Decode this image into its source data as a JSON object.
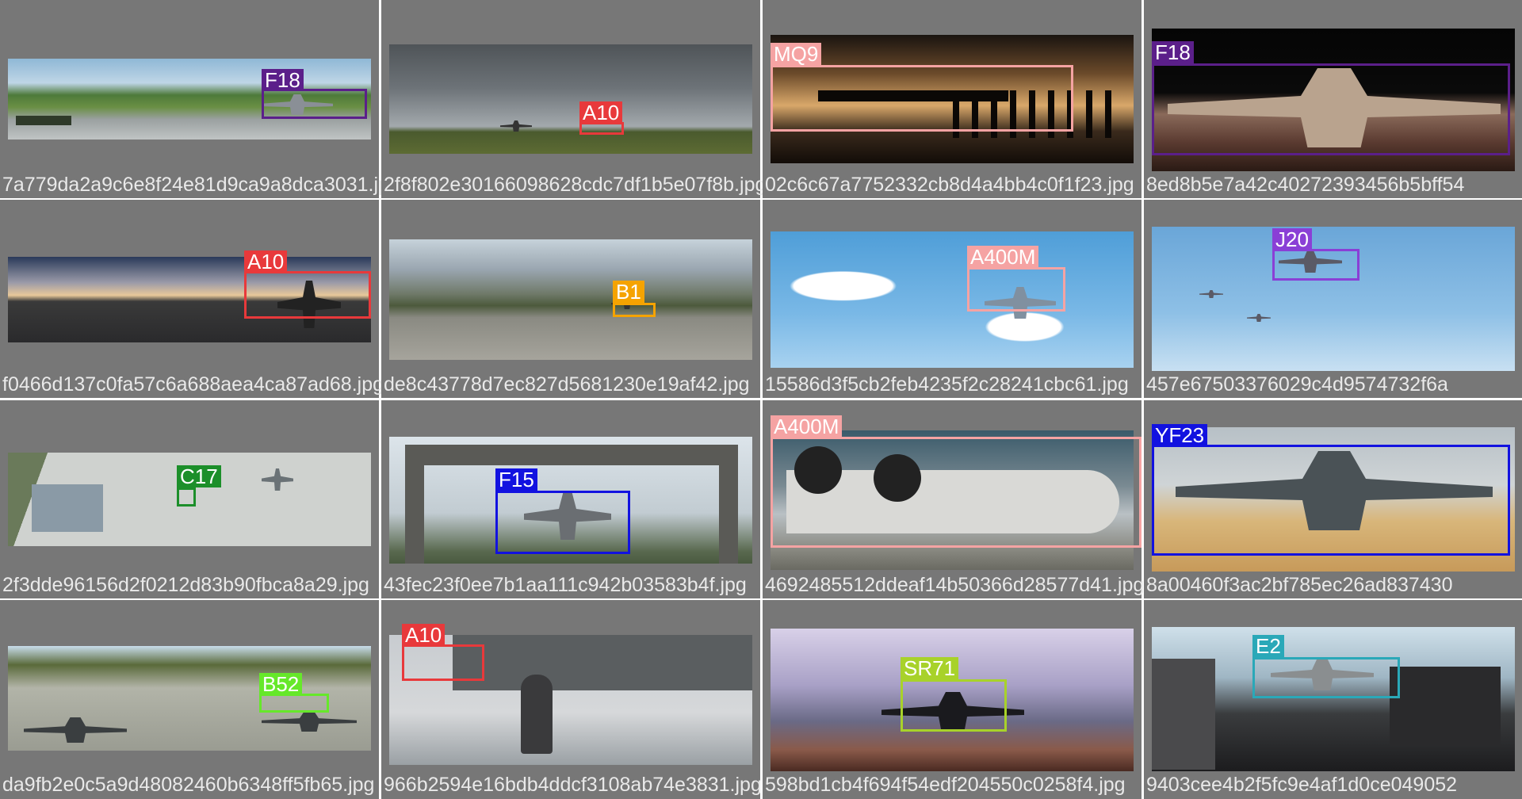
{
  "cells": [
    {
      "filename": "7a779da2a9c6e8f24e81d9ca9a8dca3031.jpg",
      "label": "F18",
      "color": "#5B1F8A"
    },
    {
      "filename": "2f8f802e30166098628cdc7df1b5e07f8b.jpg",
      "label": "A10",
      "color": "#E8393B"
    },
    {
      "filename": "02c6c67a7752332cb8d4a4bb4c0f1f23.jpg",
      "label": "MQ9",
      "color": "#F5A3A3"
    },
    {
      "filename": "8ed8b5e7a42c40272393456b5bff54",
      "label": "F18",
      "color": "#5B1F8A"
    },
    {
      "filename": "f0466d137c0fa57c6a688aea4ca87ad68.jpg",
      "label": "A10",
      "color": "#E8393B"
    },
    {
      "filename": "de8c43778d7ec827d5681230e19af42.jpg",
      "label": "B1",
      "color": "#F5A300"
    },
    {
      "filename": "15586d3f5cb2feb4235f2c28241cbc61.jpg",
      "label": "A400M",
      "color": "#F5A3A3"
    },
    {
      "filename": "457e67503376029c4d9574732f6a",
      "label": "J20",
      "color": "#8A3FD6"
    },
    {
      "filename": "2f3dde96156d2f0212d83b90fbca8a29.jpg",
      "label": "C17",
      "color": "#1C8F2A"
    },
    {
      "filename": "43fec23f0ee7b1aa111c942b03583b4f.jpg",
      "label": "F15",
      "color": "#1212E0"
    },
    {
      "filename": "4692485512ddeaf14b50366d28577d41.jpg",
      "label": "A400M",
      "color": "#F5A3A3"
    },
    {
      "filename": "8a00460f3ac2bf785ec26ad837430",
      "label": "YF23",
      "color": "#1212E0"
    },
    {
      "filename": "da9fb2e0c5a9d48082460b6348ff5fb65.jpg",
      "label": "B52",
      "color": "#66E82A"
    },
    {
      "filename": "966b2594e16bdb4ddcf3108ab74e3831.jpg",
      "label": "A10",
      "color": "#E8393B"
    },
    {
      "filename": "598bd1cb4f694f54edf204550c0258f4.jpg",
      "label": "SR71",
      "color": "#A8D22A"
    },
    {
      "filename": "9403cee4b2f5fc9e4af1d0ce049052",
      "label": "E2",
      "color": "#2AA8B8"
    }
  ]
}
